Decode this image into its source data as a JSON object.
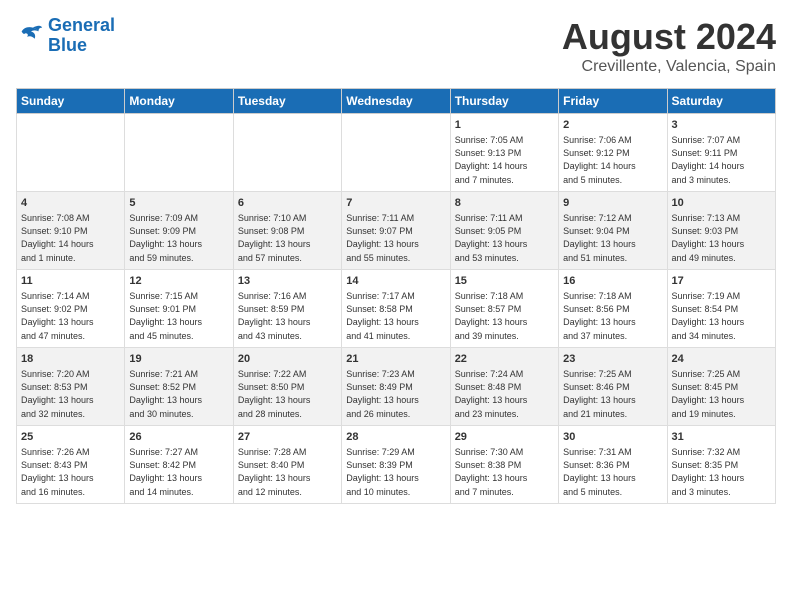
{
  "logo": {
    "line1": "General",
    "line2": "Blue"
  },
  "title": "August 2024",
  "location": "Crevillente, Valencia, Spain",
  "days_of_week": [
    "Sunday",
    "Monday",
    "Tuesday",
    "Wednesday",
    "Thursday",
    "Friday",
    "Saturday"
  ],
  "weeks": [
    [
      {
        "day": "",
        "info": ""
      },
      {
        "day": "",
        "info": ""
      },
      {
        "day": "",
        "info": ""
      },
      {
        "day": "",
        "info": ""
      },
      {
        "day": "1",
        "info": "Sunrise: 7:05 AM\nSunset: 9:13 PM\nDaylight: 14 hours\nand 7 minutes."
      },
      {
        "day": "2",
        "info": "Sunrise: 7:06 AM\nSunset: 9:12 PM\nDaylight: 14 hours\nand 5 minutes."
      },
      {
        "day": "3",
        "info": "Sunrise: 7:07 AM\nSunset: 9:11 PM\nDaylight: 14 hours\nand 3 minutes."
      }
    ],
    [
      {
        "day": "4",
        "info": "Sunrise: 7:08 AM\nSunset: 9:10 PM\nDaylight: 14 hours\nand 1 minute."
      },
      {
        "day": "5",
        "info": "Sunrise: 7:09 AM\nSunset: 9:09 PM\nDaylight: 13 hours\nand 59 minutes."
      },
      {
        "day": "6",
        "info": "Sunrise: 7:10 AM\nSunset: 9:08 PM\nDaylight: 13 hours\nand 57 minutes."
      },
      {
        "day": "7",
        "info": "Sunrise: 7:11 AM\nSunset: 9:07 PM\nDaylight: 13 hours\nand 55 minutes."
      },
      {
        "day": "8",
        "info": "Sunrise: 7:11 AM\nSunset: 9:05 PM\nDaylight: 13 hours\nand 53 minutes."
      },
      {
        "day": "9",
        "info": "Sunrise: 7:12 AM\nSunset: 9:04 PM\nDaylight: 13 hours\nand 51 minutes."
      },
      {
        "day": "10",
        "info": "Sunrise: 7:13 AM\nSunset: 9:03 PM\nDaylight: 13 hours\nand 49 minutes."
      }
    ],
    [
      {
        "day": "11",
        "info": "Sunrise: 7:14 AM\nSunset: 9:02 PM\nDaylight: 13 hours\nand 47 minutes."
      },
      {
        "day": "12",
        "info": "Sunrise: 7:15 AM\nSunset: 9:01 PM\nDaylight: 13 hours\nand 45 minutes."
      },
      {
        "day": "13",
        "info": "Sunrise: 7:16 AM\nSunset: 8:59 PM\nDaylight: 13 hours\nand 43 minutes."
      },
      {
        "day": "14",
        "info": "Sunrise: 7:17 AM\nSunset: 8:58 PM\nDaylight: 13 hours\nand 41 minutes."
      },
      {
        "day": "15",
        "info": "Sunrise: 7:18 AM\nSunset: 8:57 PM\nDaylight: 13 hours\nand 39 minutes."
      },
      {
        "day": "16",
        "info": "Sunrise: 7:18 AM\nSunset: 8:56 PM\nDaylight: 13 hours\nand 37 minutes."
      },
      {
        "day": "17",
        "info": "Sunrise: 7:19 AM\nSunset: 8:54 PM\nDaylight: 13 hours\nand 34 minutes."
      }
    ],
    [
      {
        "day": "18",
        "info": "Sunrise: 7:20 AM\nSunset: 8:53 PM\nDaylight: 13 hours\nand 32 minutes."
      },
      {
        "day": "19",
        "info": "Sunrise: 7:21 AM\nSunset: 8:52 PM\nDaylight: 13 hours\nand 30 minutes."
      },
      {
        "day": "20",
        "info": "Sunrise: 7:22 AM\nSunset: 8:50 PM\nDaylight: 13 hours\nand 28 minutes."
      },
      {
        "day": "21",
        "info": "Sunrise: 7:23 AM\nSunset: 8:49 PM\nDaylight: 13 hours\nand 26 minutes."
      },
      {
        "day": "22",
        "info": "Sunrise: 7:24 AM\nSunset: 8:48 PM\nDaylight: 13 hours\nand 23 minutes."
      },
      {
        "day": "23",
        "info": "Sunrise: 7:25 AM\nSunset: 8:46 PM\nDaylight: 13 hours\nand 21 minutes."
      },
      {
        "day": "24",
        "info": "Sunrise: 7:25 AM\nSunset: 8:45 PM\nDaylight: 13 hours\nand 19 minutes."
      }
    ],
    [
      {
        "day": "25",
        "info": "Sunrise: 7:26 AM\nSunset: 8:43 PM\nDaylight: 13 hours\nand 16 minutes."
      },
      {
        "day": "26",
        "info": "Sunrise: 7:27 AM\nSunset: 8:42 PM\nDaylight: 13 hours\nand 14 minutes."
      },
      {
        "day": "27",
        "info": "Sunrise: 7:28 AM\nSunset: 8:40 PM\nDaylight: 13 hours\nand 12 minutes."
      },
      {
        "day": "28",
        "info": "Sunrise: 7:29 AM\nSunset: 8:39 PM\nDaylight: 13 hours\nand 10 minutes."
      },
      {
        "day": "29",
        "info": "Sunrise: 7:30 AM\nSunset: 8:38 PM\nDaylight: 13 hours\nand 7 minutes."
      },
      {
        "day": "30",
        "info": "Sunrise: 7:31 AM\nSunset: 8:36 PM\nDaylight: 13 hours\nand 5 minutes."
      },
      {
        "day": "31",
        "info": "Sunrise: 7:32 AM\nSunset: 8:35 PM\nDaylight: 13 hours\nand 3 minutes."
      }
    ]
  ]
}
